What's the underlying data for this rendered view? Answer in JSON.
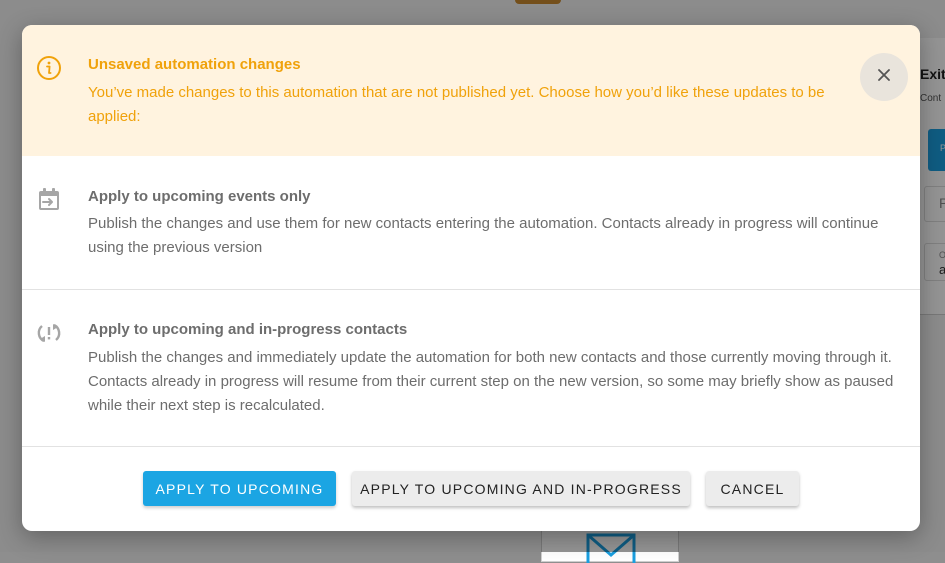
{
  "background": {
    "panel_title": "Exit",
    "panel_subtitle": "Cont",
    "panel_button": "P",
    "panel_field1": "P",
    "panel_field2_label": "O",
    "panel_field2_value": "a"
  },
  "dialog": {
    "banner": {
      "icon": "info-icon",
      "title": "Unsaved automation changes",
      "text": "You’ve made changes to this automation that are not published yet. Choose how you’d like these updates to be applied:",
      "close_icon": "close-icon"
    },
    "options": [
      {
        "icon": "calendar-arrow-icon",
        "title": "Apply to upcoming events only",
        "text": "Publish the changes and use them for new contacts entering the automation. Contacts already in progress will continue using the previous version"
      },
      {
        "icon": "sync-alert-icon",
        "title": "Apply to upcoming and in-progress contacts",
        "text": "Publish the changes and immediately update the automation for both new contacts and those currently moving through it. Contacts already in progress will resume from their current step on the new version, so some may briefly show as paused while their next step is recalculated."
      }
    ],
    "buttons": {
      "apply_upcoming": "APPLY TO UPCOMING",
      "apply_all": "APPLY TO UPCOMING AND IN-PROGRESS",
      "cancel": "CANCEL"
    }
  },
  "colors": {
    "warning": "#f0a20b",
    "banner_bg": "#fff3df",
    "primary": "#1ba5e3"
  }
}
